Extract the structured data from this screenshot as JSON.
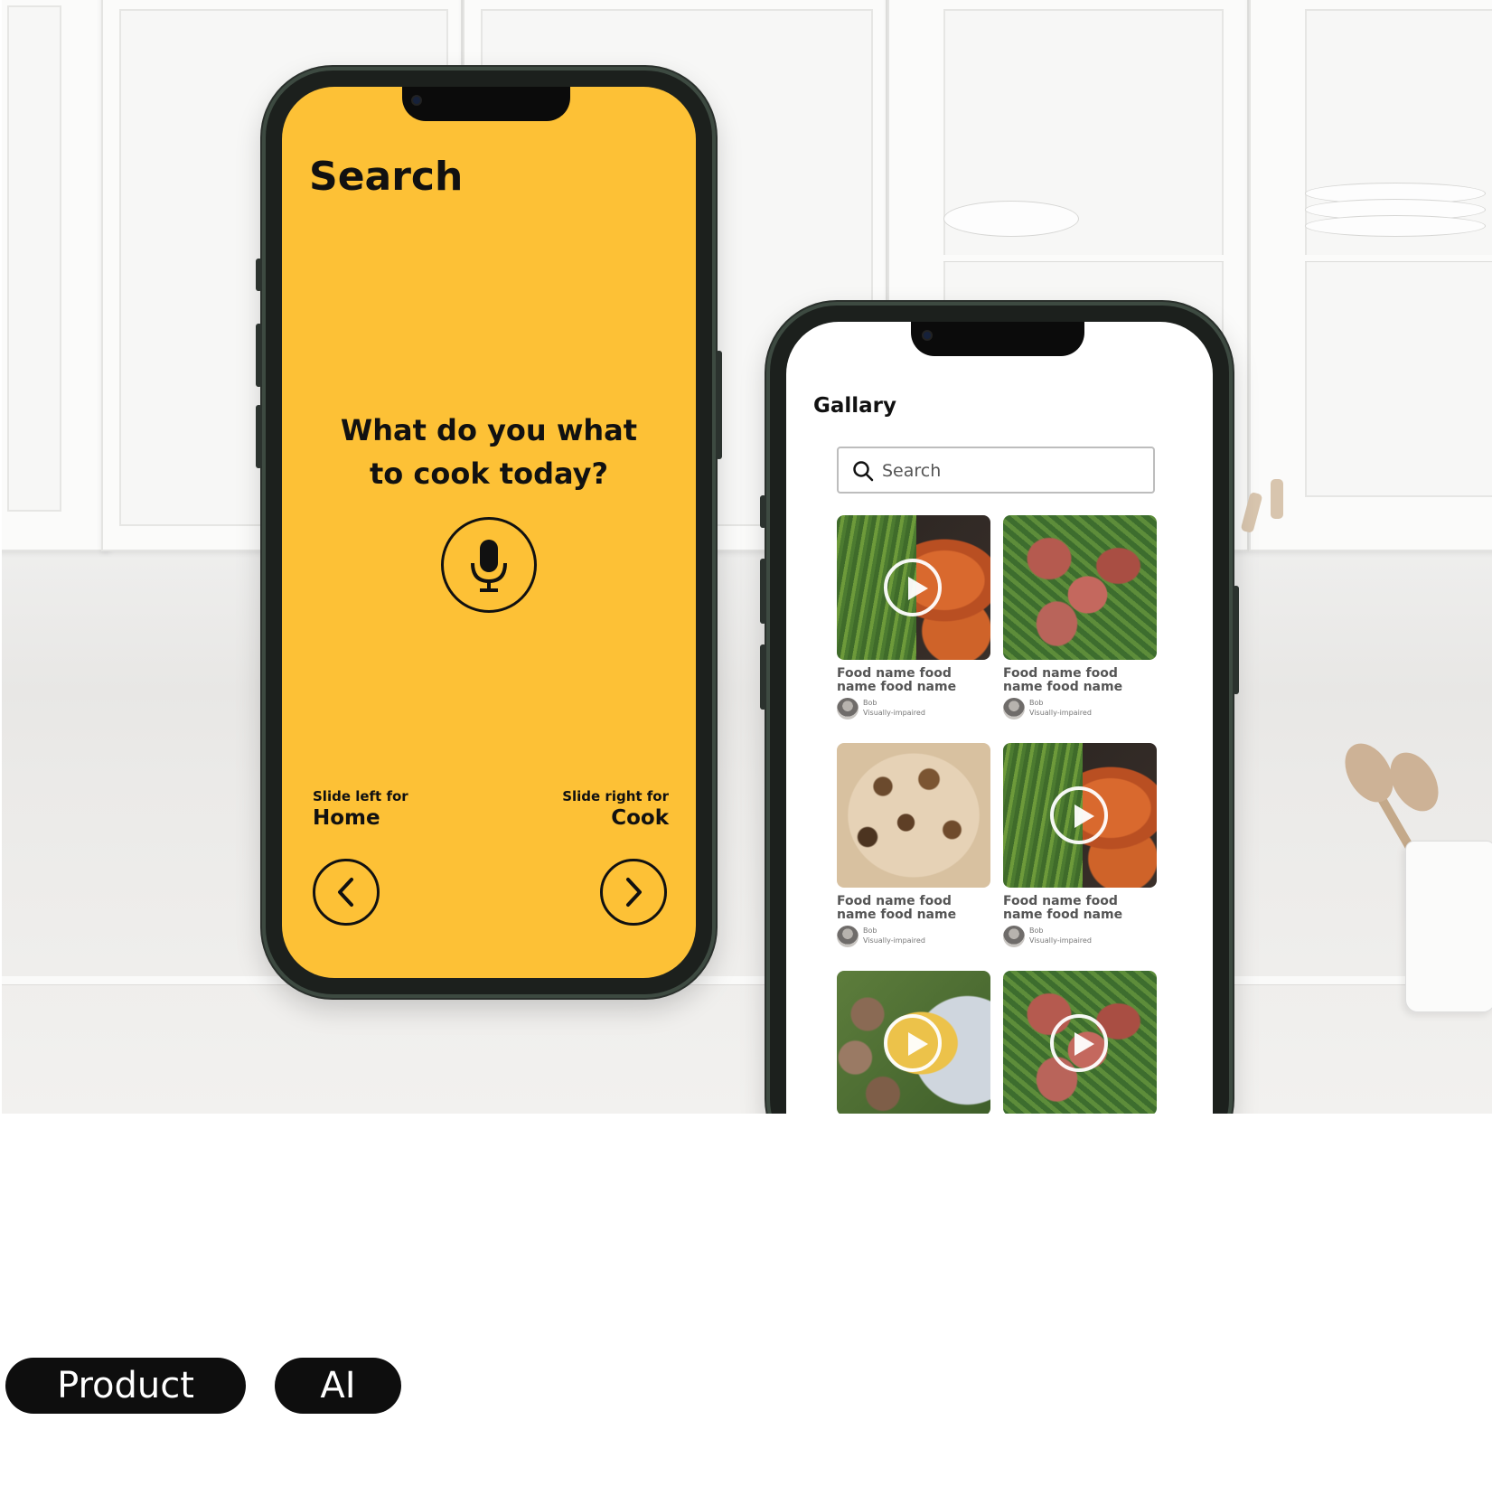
{
  "search_screen": {
    "title": "Search",
    "question": "What do you what to cook today?",
    "mic_icon": "microphone-icon",
    "left": {
      "hint": "Slide left for",
      "target": "Home",
      "icon": "chevron-left-icon"
    },
    "right": {
      "hint": "Slide right for",
      "target": "Cook",
      "icon": "chevron-right-icon"
    },
    "background_color": "#fdc136"
  },
  "gallery_screen": {
    "title": "Gallary",
    "search_placeholder": "Search",
    "search_icon": "magnifier-icon",
    "cards": [
      {
        "name": "Food name food name food name",
        "author": "Bob",
        "tag": "Visually-impaired",
        "video": true
      },
      {
        "name": "Food name food name food name",
        "author": "Bob",
        "tag": "Visually-impaired",
        "video": false
      },
      {
        "name": "Food name food name food name",
        "author": "Bob",
        "tag": "Visually-impaired",
        "video": false
      },
      {
        "name": "Food name food name food name",
        "author": "Bob",
        "tag": "Visually-impaired",
        "video": true
      },
      {
        "video": true
      },
      {
        "video": true
      }
    ]
  },
  "tags": [
    {
      "label": "Product"
    },
    {
      "label": "AI"
    }
  ]
}
